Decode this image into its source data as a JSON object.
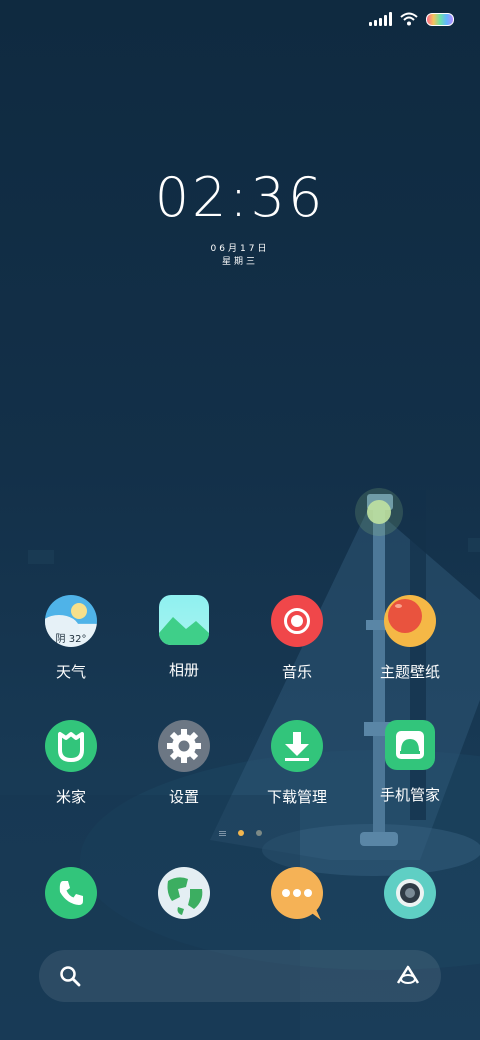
{
  "status_bar": {
    "signal_icon": "signal-icon",
    "wifi_icon": "wifi-icon",
    "battery_icon": "battery-icon"
  },
  "lock_clock": {
    "time": "02:36",
    "date": "06月17日",
    "weekday": "星期三"
  },
  "apps_row1": [
    {
      "label": "天气",
      "icon": "weather-icon",
      "badge": "阴 32°"
    },
    {
      "label": "相册",
      "icon": "gallery-icon"
    },
    {
      "label": "音乐",
      "icon": "music-icon"
    },
    {
      "label": "主题壁纸",
      "icon": "themes-icon"
    }
  ],
  "apps_row2": [
    {
      "label": "米家",
      "icon": "mihome-icon"
    },
    {
      "label": "设置",
      "icon": "settings-icon"
    },
    {
      "label": "下载管理",
      "icon": "download-icon"
    },
    {
      "label": "手机管家",
      "icon": "security-icon"
    }
  ],
  "page_indicator": {
    "pages": 3,
    "current": 1
  },
  "dock": [
    {
      "icon": "phone-icon"
    },
    {
      "icon": "browser-icon"
    },
    {
      "icon": "messages-icon"
    },
    {
      "icon": "camera-icon"
    }
  ],
  "search_bar": {
    "search_icon": "search-icon",
    "assistant_icon": "assistant-icon"
  },
  "colors": {
    "bg_top": "#0f2a40",
    "bg_bottom": "#1a3d59",
    "accent_dot": "#f3b64e"
  }
}
